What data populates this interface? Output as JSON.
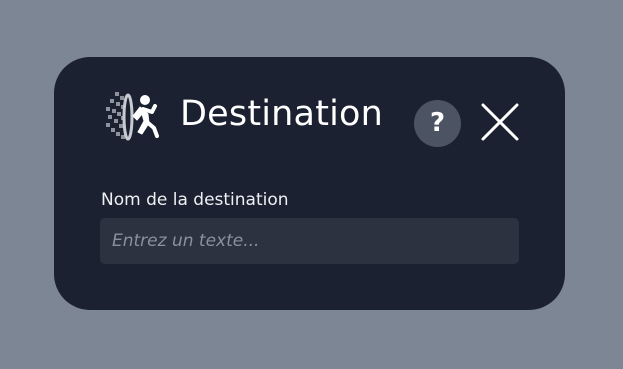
{
  "dialog": {
    "title": "Destination",
    "app_icon": "portal-runner-icon",
    "help_label": "?",
    "close_icon": "close-icon"
  },
  "field": {
    "label": "Nom de la destination",
    "value": "",
    "placeholder": "Entrez un texte..."
  },
  "colors": {
    "backdrop": "#7d8695",
    "dialog_background": "#1b2130",
    "input_background": "#2c3240",
    "help_button": "#4c5463",
    "text": "#ffffff",
    "placeholder": "#8a919e"
  }
}
